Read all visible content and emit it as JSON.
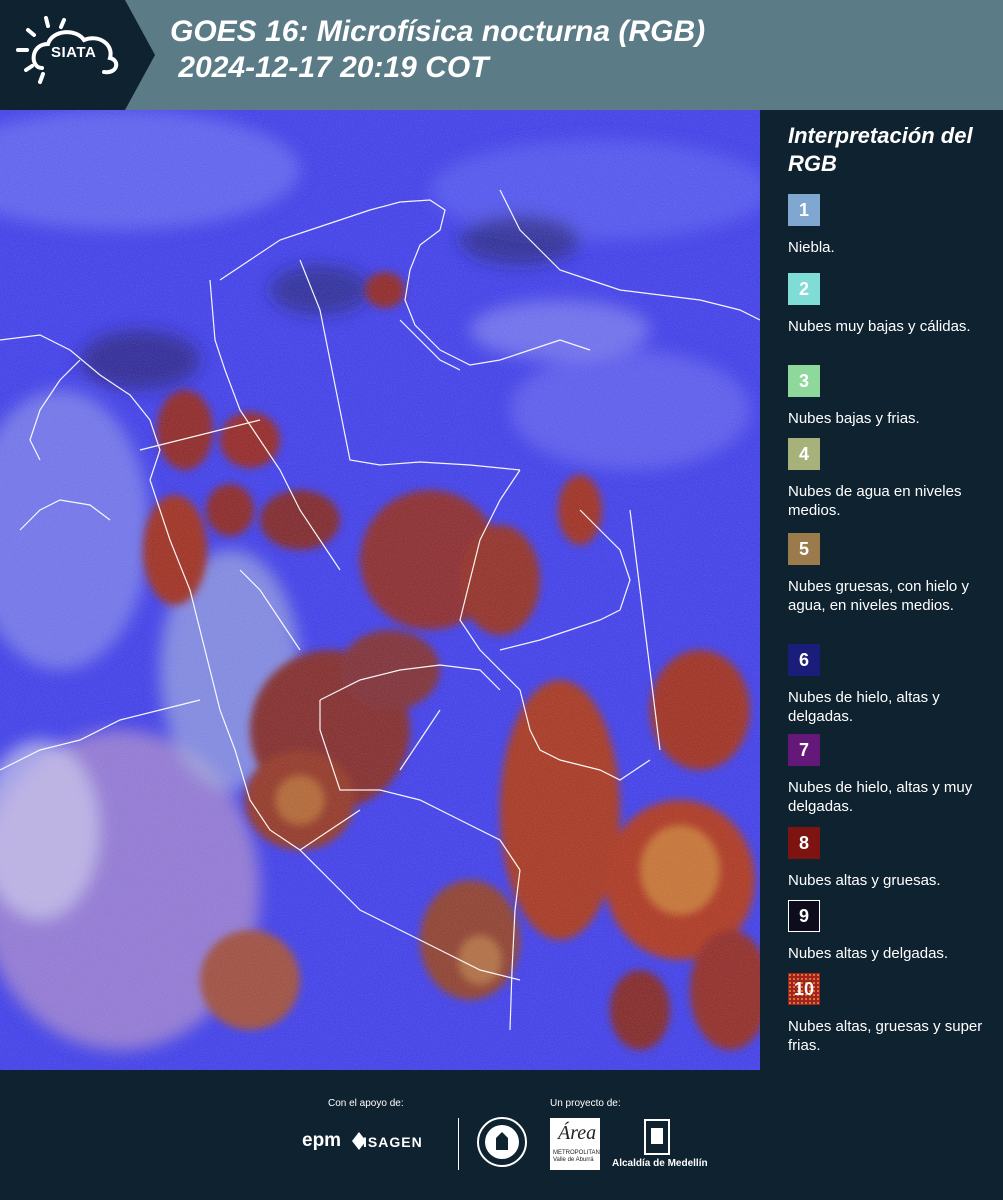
{
  "header": {
    "logo_text": "SIATA",
    "title_line1": "GOES 16: Microfísica nocturna (RGB)",
    "title_line2": " 2024-12-17 20:19 COT"
  },
  "legend": {
    "title": "Interpretación del RGB",
    "items": [
      {
        "number": "1",
        "label": "Niebla.",
        "color": "#7fa7cf"
      },
      {
        "number": "2",
        "label": "Nubes muy bajas y cálidas.",
        "color": "#7fdcd6"
      },
      {
        "number": "3",
        "label": "Nubes bajas y frias.",
        "color": "#8fd89b"
      },
      {
        "number": "4",
        "label": "Nubes de agua en niveles medios.",
        "color": "#a6b27a"
      },
      {
        "number": "5",
        "label": "Nubes gruesas, con hielo y agua, en niveles medios.",
        "color": "#9b7a4b"
      },
      {
        "number": "6",
        "label": "Nubes de hielo, altas y delgadas.",
        "color": "#1b1d7a"
      },
      {
        "number": "7",
        "label": "Nubes de hielo, altas y muy delgadas.",
        "color": "#64197a"
      },
      {
        "number": "8",
        "label": "Nubes altas y gruesas.",
        "color": "#7d1411"
      },
      {
        "number": "9",
        "label": "Nubes altas y delgadas.",
        "color": "#0c0c1c"
      },
      {
        "number": "10",
        "label": "Nubes altas, gruesas y super frias.",
        "color": "#a0231c"
      }
    ]
  },
  "footer": {
    "support_label": "Con el apoyo de:",
    "project_label": "Un proyecto de:",
    "epm": "epm",
    "isagen": "ISAGEN",
    "area_word": "Área",
    "area_sub": "METROPOLITANA Valle de Aburrá",
    "alcaldia": "Alcaldía de Medellín"
  }
}
